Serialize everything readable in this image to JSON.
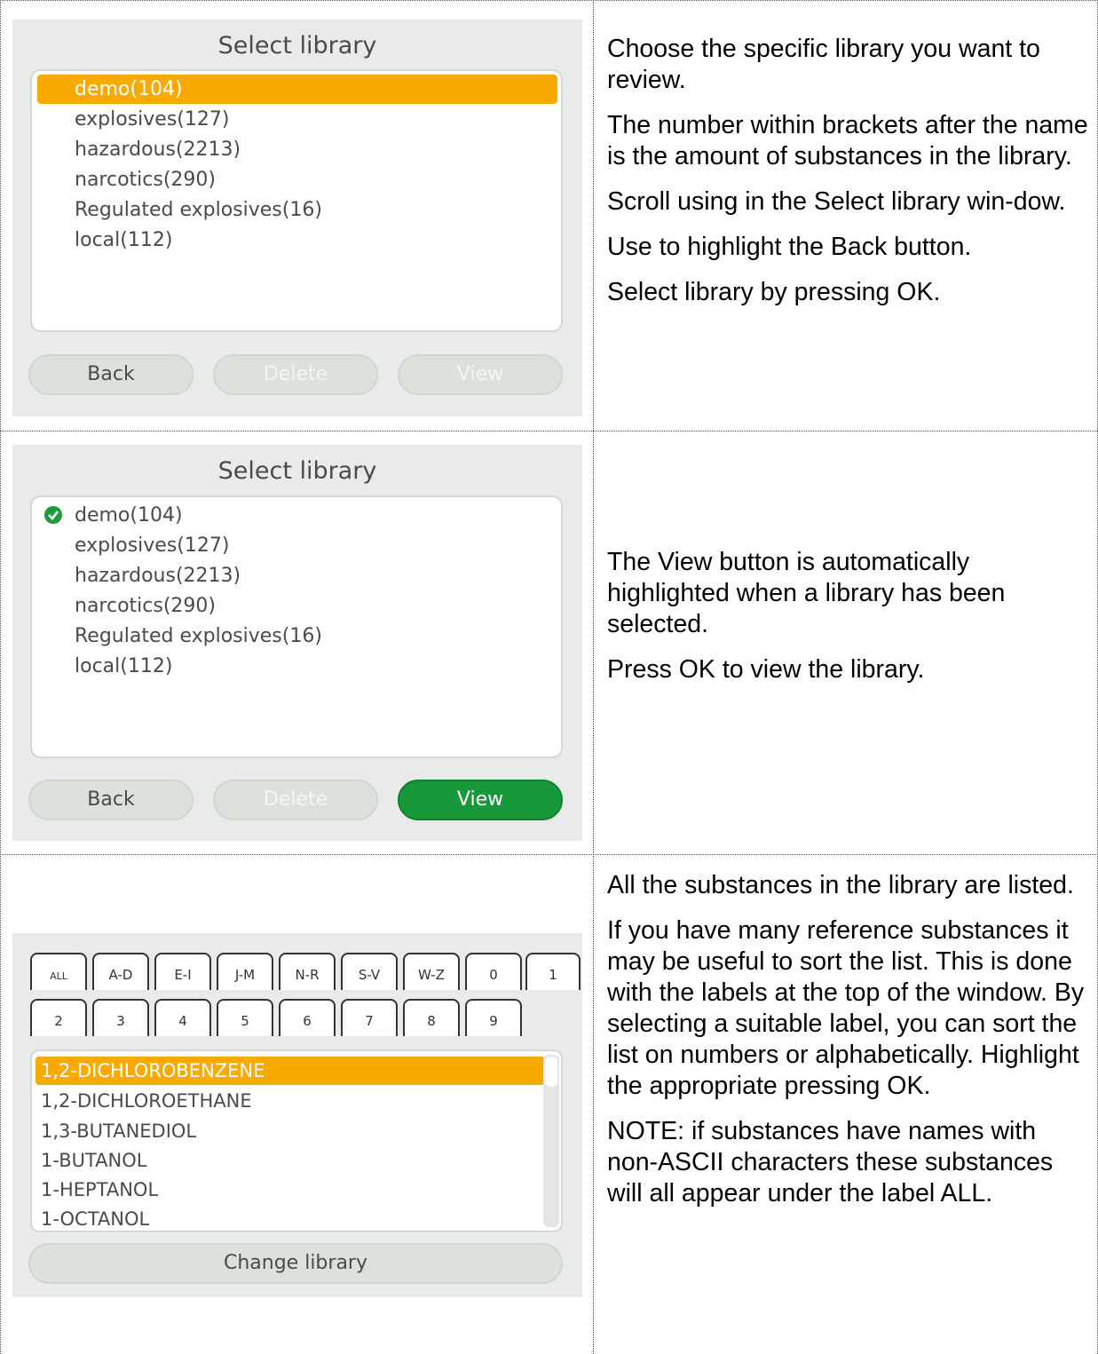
{
  "panel1": {
    "title": "Select library",
    "items": [
      "demo(104)",
      "explosives(127)",
      "hazardous(2213)",
      "narcotics(290)",
      "Regulated explosives(16)",
      "local(112)"
    ],
    "buttons": {
      "back": "Back",
      "delete": "Delete",
      "view": "View"
    },
    "text": [
      "Choose the specific library you want to review.",
      "The number within brackets after the name is the amount of substances in the library.",
      "Scroll using   in the Select library win-dow.",
      "Use   to highlight the Back button.",
      "Select library by pressing OK."
    ]
  },
  "panel2": {
    "title": "Select library",
    "items": [
      "demo(104)",
      "explosives(127)",
      "hazardous(2213)",
      "narcotics(290)",
      "Regulated explosives(16)",
      "local(112)"
    ],
    "buttons": {
      "back": "Back",
      "delete": "Delete",
      "view": "View"
    },
    "text": [
      "The View button is automatically highlighted when a library has been selected.",
      "Press OK to view the library."
    ]
  },
  "panel3": {
    "tabs_row1": [
      "ALL",
      "A-D",
      "E-I",
      "J-M",
      "N-R",
      "S-V",
      "W-Z",
      "0",
      "1"
    ],
    "tabs_row2": [
      "2",
      "3",
      "4",
      "5",
      "6",
      "7",
      "8",
      "9"
    ],
    "items": [
      "1,2-DICHLOROBENZENE",
      "1,2-DICHLOROETHANE",
      "1,3-BUTANEDIOL",
      "1-BUTANOL",
      "1-HEPTANOL",
      "1-OCTANOL"
    ],
    "change_button": "Change library",
    "text": [
      "All the substances in the library are listed.",
      "If you have many reference substances it may be useful to sort the list. This is done with the labels at the top of the window. By selecting a suitable label, you can sort the list on numbers or alphabetically. Highlight the appropriate pressing OK.",
      "NOTE: if substances have names with non-ASCII characters these substances will all appear under the label ALL."
    ]
  },
  "colors": {
    "accent": "#f8aa00",
    "green": "#17993a",
    "panel_bg": "#e9ebea"
  }
}
